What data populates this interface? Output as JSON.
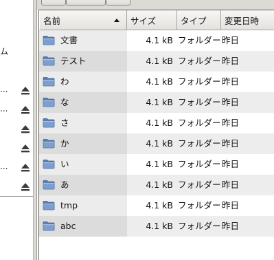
{
  "sidebar": {
    "fragments": [
      {
        "text": "ム"
      }
    ],
    "rows": [
      {
        "dots": "...",
        "icon": "eject-icon"
      },
      {
        "dots": "...",
        "icon": "eject-icon"
      },
      {
        "dots": "",
        "icon": "eject-icon"
      },
      {
        "dots": "",
        "icon": "eject-icon"
      },
      {
        "dots": "...",
        "icon": "eject-icon"
      },
      {
        "dots": "",
        "icon": "eject-icon"
      }
    ]
  },
  "columns": {
    "name": "名前",
    "size": "サイズ",
    "type": "タイプ",
    "modified": "変更日時",
    "sort": "ascending"
  },
  "files": [
    {
      "name": "文書",
      "size": "4.1 kB",
      "type": "フォルダー",
      "modified": "昨日",
      "icon": "folder-icon"
    },
    {
      "name": "テスト",
      "size": "4.1 kB",
      "type": "フォルダー",
      "modified": "昨日",
      "icon": "folder-icon"
    },
    {
      "name": "わ",
      "size": "4.1 kB",
      "type": "フォルダー",
      "modified": "昨日",
      "icon": "folder-icon"
    },
    {
      "name": "な",
      "size": "4.1 kB",
      "type": "フォルダー",
      "modified": "昨日",
      "icon": "folder-icon"
    },
    {
      "name": "さ",
      "size": "4.1 kB",
      "type": "フォルダー",
      "modified": "昨日",
      "icon": "folder-icon"
    },
    {
      "name": "か",
      "size": "4.1 kB",
      "type": "フォルダー",
      "modified": "昨日",
      "icon": "folder-icon"
    },
    {
      "name": "い",
      "size": "4.1 kB",
      "type": "フォルダー",
      "modified": "昨日",
      "icon": "folder-icon"
    },
    {
      "name": "あ",
      "size": "4.1 kB",
      "type": "フォルダー",
      "modified": "昨日",
      "icon": "folder-icon"
    },
    {
      "name": "tmp",
      "size": "4.1 kB",
      "type": "フォルダー",
      "modified": "昨日",
      "icon": "folder-icon"
    },
    {
      "name": "abc",
      "size": "4.1 kB",
      "type": "フォルダー",
      "modified": "昨日",
      "icon": "folder-icon"
    }
  ],
  "colors": {
    "folder_fill": "#6f93c4",
    "folder_tab": "#5b80b4",
    "header_border": "#a4a29d"
  }
}
